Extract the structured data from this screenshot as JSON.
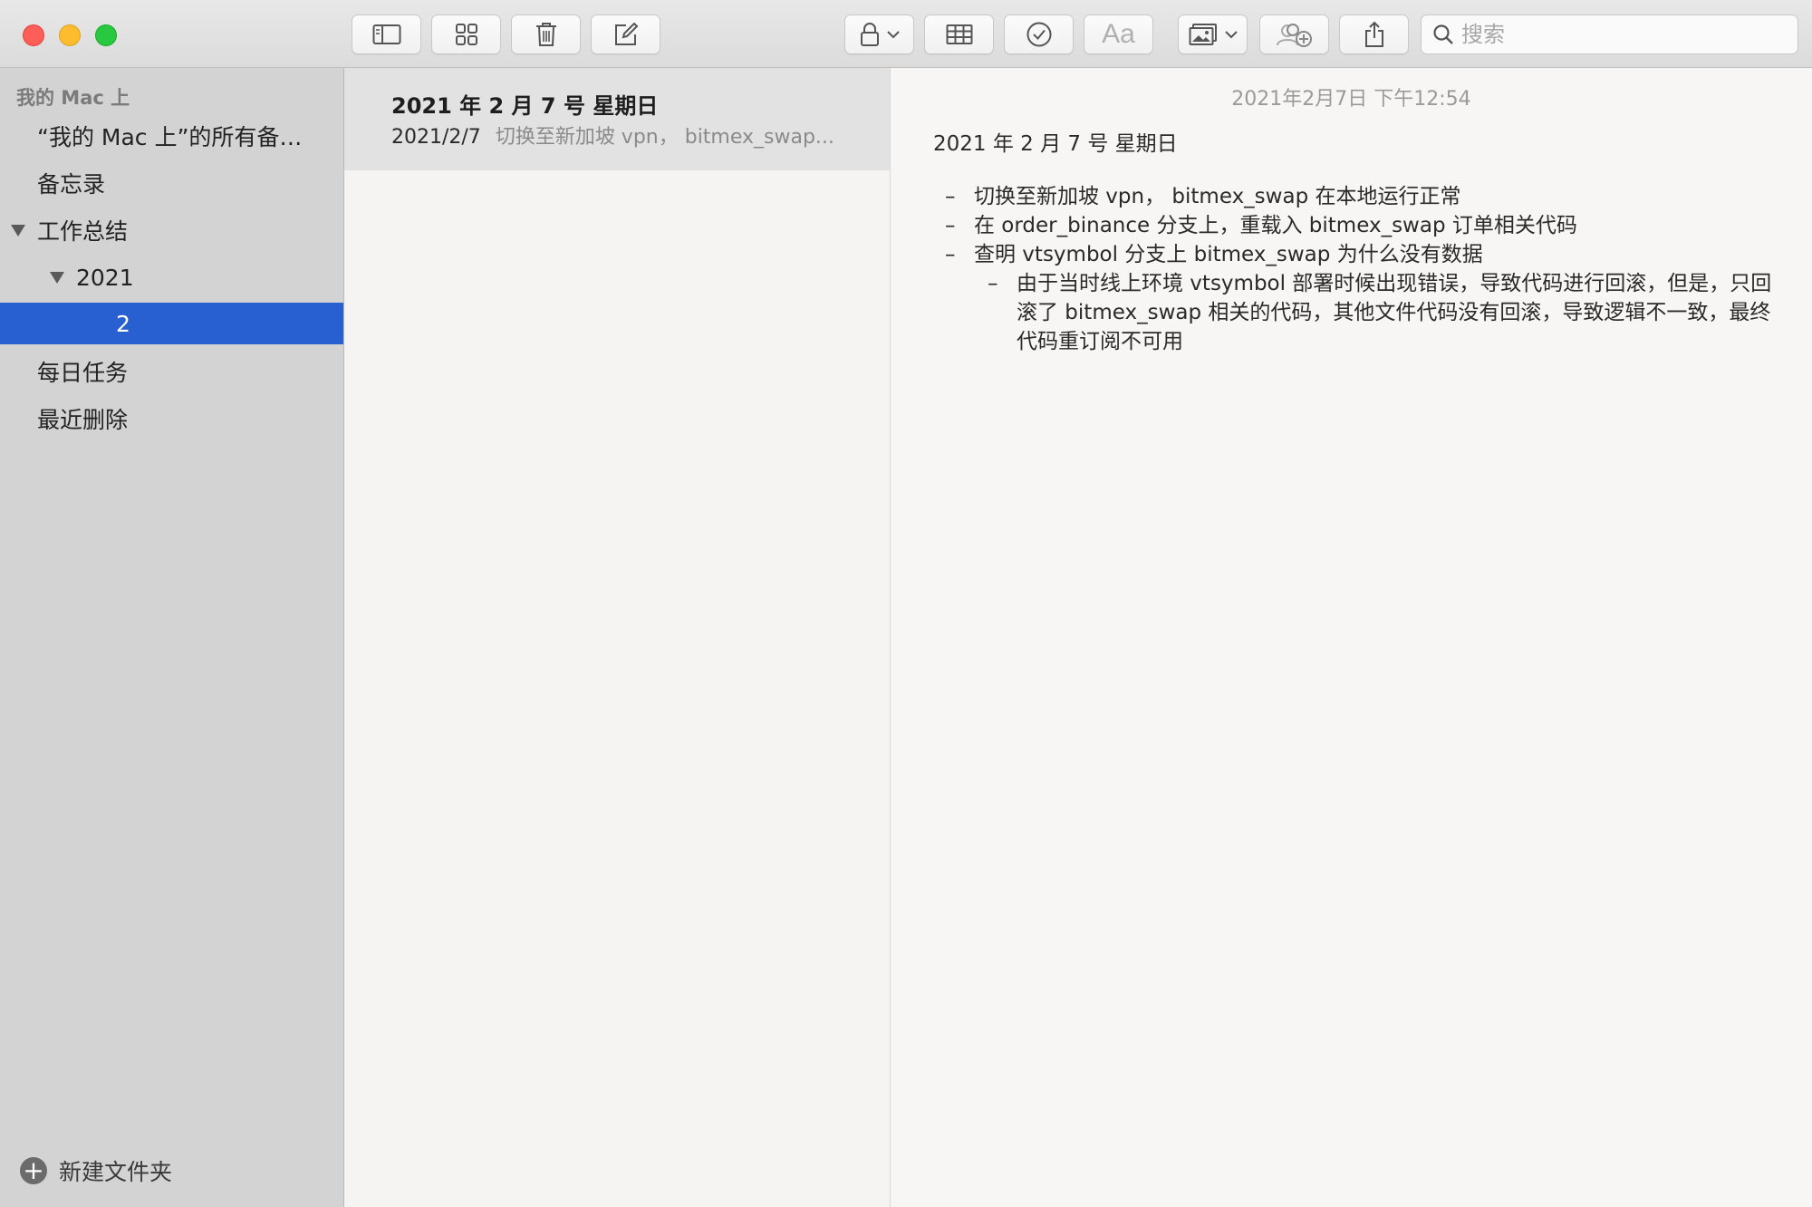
{
  "toolbar": {
    "search_placeholder": "搜索",
    "font_button_label": "Aa",
    "buttons": [
      {
        "name": "toggle-sidebar",
        "icon": "sidebar-icon"
      },
      {
        "name": "gallery-view",
        "icon": "grid-icon"
      },
      {
        "name": "delete",
        "icon": "trash-icon"
      },
      {
        "name": "compose",
        "icon": "compose-icon"
      },
      {
        "name": "lock",
        "icon": "lock-icon"
      },
      {
        "name": "table",
        "icon": "table-icon"
      },
      {
        "name": "checklist",
        "icon": "checklist-icon"
      },
      {
        "name": "format",
        "icon": "text-format-icon"
      },
      {
        "name": "media",
        "icon": "photo-icon"
      },
      {
        "name": "collaborate",
        "icon": "add-people-icon"
      },
      {
        "name": "share",
        "icon": "share-icon"
      }
    ]
  },
  "colors": {
    "accent": "#2960d1",
    "close": "#fd5f58",
    "minimize": "#fdbc2e",
    "maximize": "#28c840"
  },
  "sidebar": {
    "header": "我的 Mac 上",
    "items": [
      {
        "label": "“我的 Mac 上”的所有备…"
      },
      {
        "label": "备忘录"
      },
      {
        "label": "工作总结"
      },
      {
        "label": "2021"
      },
      {
        "label": "2"
      },
      {
        "label": "每日任务"
      },
      {
        "label": "最近删除"
      }
    ],
    "new_folder": "新建文件夹"
  },
  "notelist": {
    "notes": [
      {
        "title": "2021 年 2 月 7 号 星期日",
        "date": "2021/2/7",
        "preview": "切换至新加坡 vpn， bitmex_swap..."
      }
    ]
  },
  "editor": {
    "timestamp": "2021年2月7日 下午12:54",
    "heading": "2021 年 2 月 7 号 星期日",
    "bullets": [
      "切换至新加坡 vpn， bitmex_swap 在本地运行正常",
      "在 order_binance 分支上，重载入 bitmex_swap 订单相关代码",
      "查明 vtsymbol 分支上 bitmex_swap 为什么没有数据"
    ],
    "sub_bullets": [
      "由于当时线上环境 vtsymbol 部署时候出现错误，导致代码进行回滚，但是，只回滚了 bitmex_swap 相关的代码，其他文件代码没有回滚，导致逻辑不一致，最终代码重订阅不可用"
    ]
  }
}
